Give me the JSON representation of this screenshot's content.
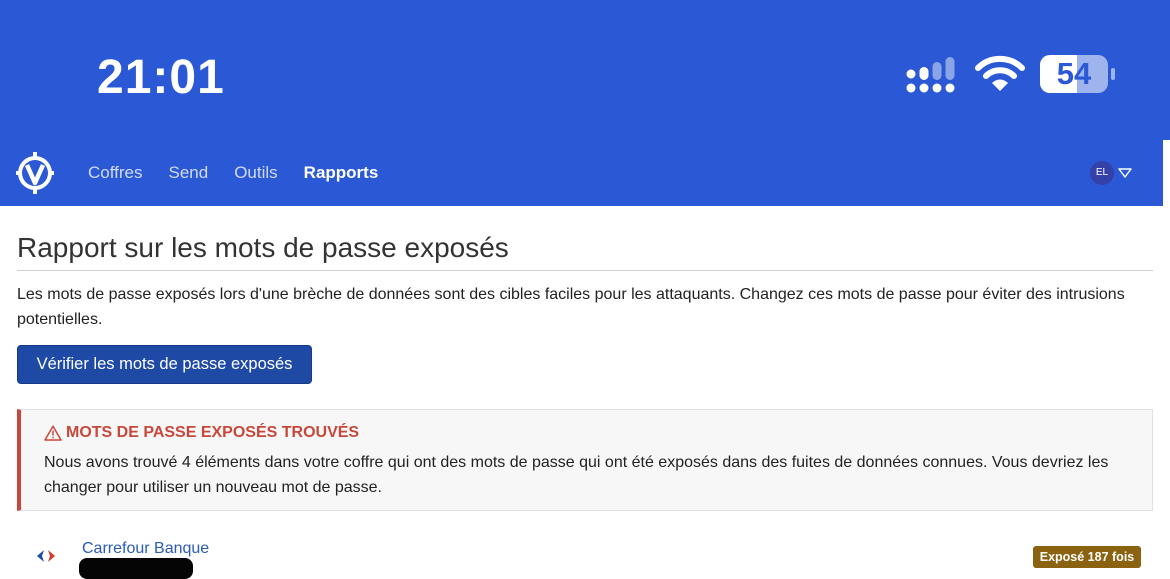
{
  "status_bar": {
    "time": "21:01",
    "battery_level": "54",
    "icons": [
      "cellular-signal-icon",
      "wifi-icon",
      "battery-icon"
    ]
  },
  "navbar": {
    "logo": "vaultwarden-logo-icon",
    "links": [
      {
        "label": "Coffres",
        "active": false
      },
      {
        "label": "Send",
        "active": false
      },
      {
        "label": "Outils",
        "active": false
      },
      {
        "label": "Rapports",
        "active": true
      }
    ],
    "avatar_initials": "EL",
    "menu_icon": "chevron-down-icon"
  },
  "page": {
    "title": "Rapport sur les mots de passe exposés",
    "description": "Les mots de passe exposés lors d'une brèche de données sont des cibles faciles pour les attaquants. Changez ces mots de passe pour éviter des intrusions potentielles.",
    "check_button_label": "Vérifier les mots de passe exposés"
  },
  "alert": {
    "title": "MOTS DE PASSE EXPOSÉS TROUVÉS",
    "body": "Nous avons trouvé 4 éléments dans votre coffre qui ont des mots de passe qui ont été exposés dans des fuites de données connues. Vous devriez les changer pour utiliser un nouveau mot de passe.",
    "icon": "warning-icon"
  },
  "items": [
    {
      "name": "Carrefour Banque",
      "badge": "Exposé 187 fois",
      "icon": "carrefour-logo-icon"
    }
  ],
  "colors": {
    "brand_blue": "#2b59d6",
    "button_blue": "#1e4aa6",
    "danger_red": "#c9473a",
    "badge_gold": "#8a6210",
    "link_blue": "#2a5bb8"
  }
}
